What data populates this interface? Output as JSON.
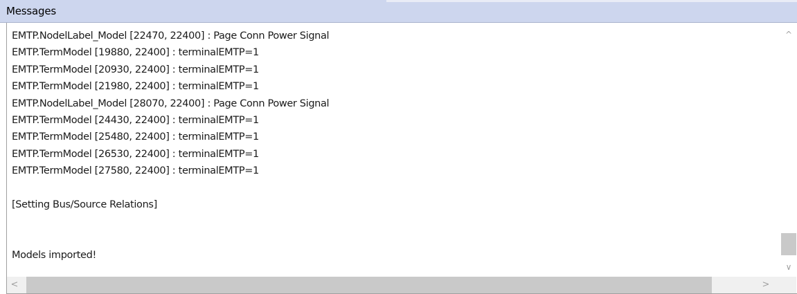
{
  "panel": {
    "title": "Messages"
  },
  "messages": [
    "EMTP.NodelLabel_Model [22470, 22400] : Page Conn Power Signal",
    "EMTP.TermModel [19880, 22400] : terminalEMTP=1",
    "EMTP.TermModel [20930, 22400] : terminalEMTP=1",
    "EMTP.TermModel [21980, 22400] : terminalEMTP=1",
    "EMTP.NodelLabel_Model [28070, 22400] : Page Conn Power Signal",
    "EMTP.TermModel [24430, 22400] : terminalEMTP=1",
    "EMTP.TermModel [25480, 22400] : terminalEMTP=1",
    "EMTP.TermModel [26530, 22400] : terminalEMTP=1",
    "EMTP.TermModel [27580, 22400] : terminalEMTP=1",
    "",
    "[Setting Bus/Source Relations]",
    "",
    "",
    "Models imported!"
  ],
  "scrollbars": {
    "up_glyph": "^",
    "down_glyph": "∨",
    "left_glyph": "<",
    "right_glyph": ">"
  },
  "colors": {
    "title_bar": "#cdd6ee",
    "text": "#1a1a1a",
    "scroll_thumb": "#c9c9c9"
  }
}
